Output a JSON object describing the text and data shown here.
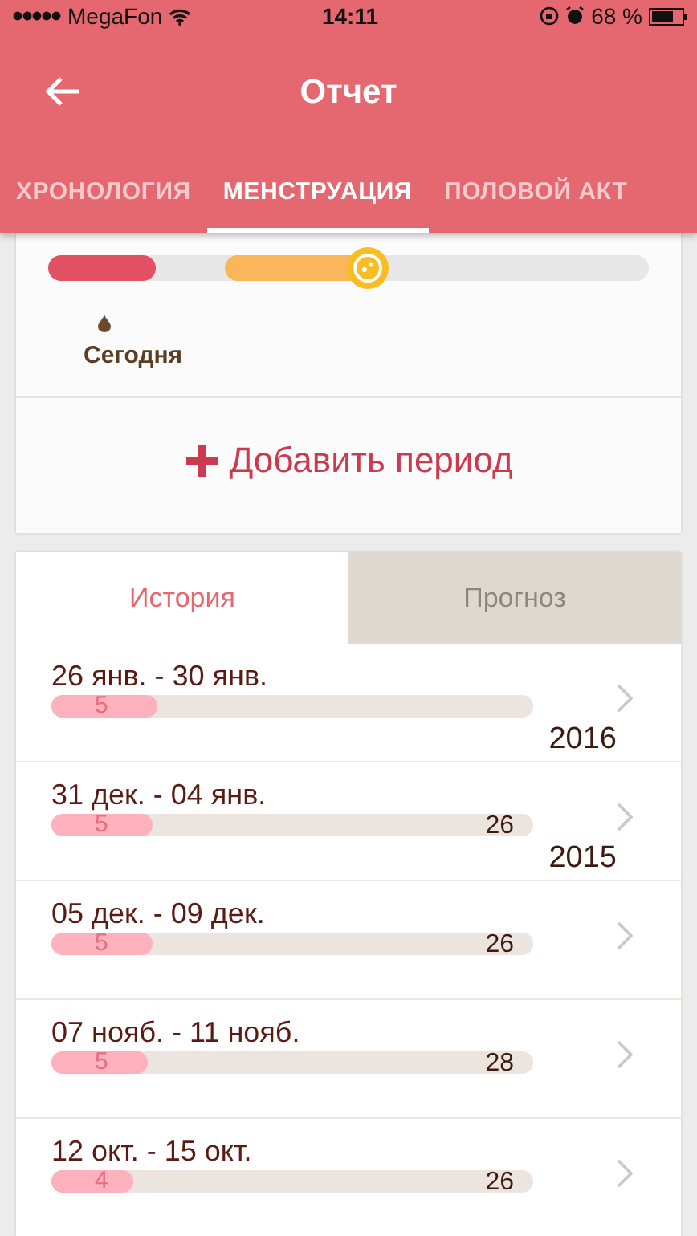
{
  "status_bar": {
    "carrier": "MegaFon",
    "time": "14:11",
    "battery": "68 %"
  },
  "header": {
    "title": "Отчет"
  },
  "tabs": [
    {
      "label": "ХРОНОЛОГИЯ",
      "selected": false
    },
    {
      "label": "МЕНСТРУАЦИЯ",
      "selected": true
    },
    {
      "label": "ПОЛОВОЙ АКТ",
      "selected": false
    }
  ],
  "current_cycle": {
    "level": 0.18,
    "today_label": "Сегодня"
  },
  "add_button": {
    "label": "Добавить период"
  },
  "history_tabs": [
    {
      "label": "История",
      "selected": true
    },
    {
      "label": "Прогноз",
      "selected": false
    }
  ],
  "periods": [
    {
      "dates": "26 янв. - 30 янв.",
      "days": "5",
      "level": 0.22,
      "year": "2016"
    },
    {
      "dates": "31 дек. - 04 янв.",
      "days": "5",
      "cycle": "26",
      "level": 0.21,
      "year": "2015"
    },
    {
      "dates": "05 дек. - 09 дек.",
      "days": "5",
      "cycle": "26",
      "level": 0.21
    },
    {
      "dates": "07 нояб. - 11 нояб.",
      "days": "5",
      "cycle": "28",
      "level": 0.2
    },
    {
      "dates": "12 окт. - 15 окт.",
      "days": "4",
      "cycle": "26",
      "level": 0.17
    }
  ]
}
